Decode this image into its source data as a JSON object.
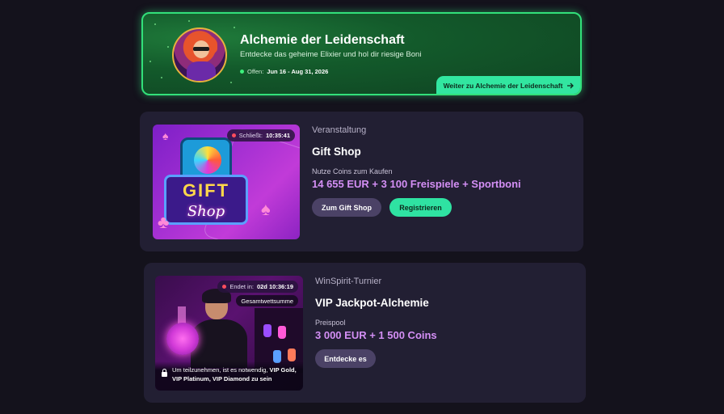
{
  "hero": {
    "title": "Alchemie der Leidenschaft",
    "subtitle": "Entdecke das geheime Elixier und hol dir riesige Boni",
    "status_label": "Offen:",
    "dates": "Jun 16 - Aug 31, 2026",
    "cta_label": "Weiter zu Alchemie der Leidenschaft",
    "cta_icon": "arrow-right-icon"
  },
  "events": [
    {
      "type": "Veranstaltung",
      "title": "Gift Shop",
      "label": "Nutze Coins zum Kaufen",
      "prize": "14 655 EUR + 3 100 Freispiele + Sportboni",
      "timer_label": "Schließt:",
      "timer_value": "10:35:41",
      "thumb_text_1": "GIFT",
      "thumb_text_2": "Shop",
      "secondary_button": "Zum Gift Shop",
      "primary_button": "Registrieren"
    },
    {
      "type": "WinSpirit-Turnier",
      "title": "VIP Jackpot-Alchemie",
      "label": "Preispool",
      "prize": "3 000 EUR + 1 500 Coins",
      "timer_label": "Endet in:",
      "timer_value": "02d 10:36:19",
      "pill": "Gesamtwettsumme",
      "note_prefix": "Um teilzunehmen, ist es notwendig,",
      "note_bold": "VIP Gold, VIP Platinum, VIP Diamond zu sein",
      "secondary_button": "Entdecke es"
    }
  ],
  "colors": {
    "background": "#14121c",
    "card": "#221f33",
    "hero_border": "#32e07a",
    "primary_button": "#2fe2a2",
    "prize_text": "#d48ff5"
  }
}
